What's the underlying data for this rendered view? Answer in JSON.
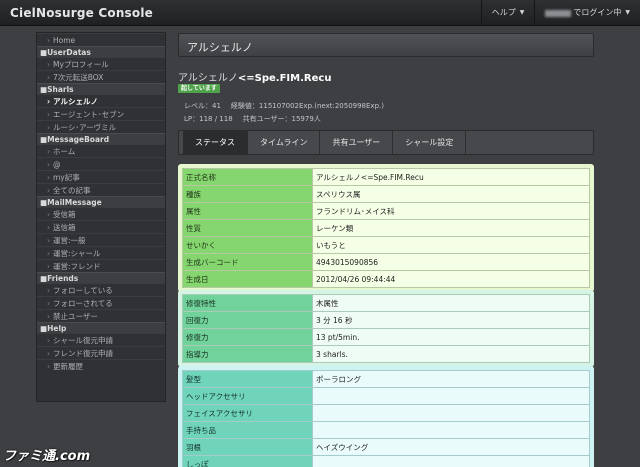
{
  "header": {
    "brand": "CielNosurge Console",
    "help_label": "ヘルプ",
    "login_label": "でログイン中"
  },
  "sidebar": {
    "sections": [
      {
        "title": "",
        "items": [
          {
            "label": "Home",
            "active": false
          }
        ]
      },
      {
        "title": "UserDatas",
        "items": [
          {
            "label": "Myプロフィール",
            "active": false
          },
          {
            "label": "7次元転送BOX",
            "active": false
          }
        ]
      },
      {
        "title": "Sharls",
        "items": [
          {
            "label": "アルシェルノ",
            "active": true
          },
          {
            "label": "エージェント･セブン",
            "active": false
          },
          {
            "label": "ルーシ･アーヴミル",
            "active": false
          }
        ]
      },
      {
        "title": "MessageBoard",
        "items": [
          {
            "label": "ホーム",
            "active": false
          },
          {
            "label": "@",
            "active": false
          },
          {
            "label": "my記事",
            "active": false
          },
          {
            "label": "全ての記事",
            "active": false
          }
        ]
      },
      {
        "title": "MailMessage",
        "items": [
          {
            "label": "受信箱",
            "active": false
          },
          {
            "label": "送信箱",
            "active": false
          },
          {
            "label": "運営:一般",
            "active": false
          },
          {
            "label": "運営:シャール",
            "active": false
          },
          {
            "label": "運営:フレンド",
            "active": false
          }
        ]
      },
      {
        "title": "Friends",
        "items": [
          {
            "label": "フォローしている",
            "active": false
          },
          {
            "label": "フォローされてる",
            "active": false
          },
          {
            "label": "禁止ユーザー",
            "active": false
          }
        ]
      },
      {
        "title": "Help",
        "items": [
          {
            "label": "シャール復元申請",
            "active": false
          },
          {
            "label": "フレンド復元申請",
            "active": false
          },
          {
            "label": "更新履歴",
            "active": false
          }
        ]
      }
    ]
  },
  "page": {
    "title": "アルシェルノ",
    "sharl_name_prefix": "アルシェルノ",
    "sharl_name_suffix": "<=Spe.FIM.Recu",
    "status_badge": "起しています",
    "level": "レベル：41",
    "exp": "経験値：115107002Exp.(next:2050998Exp.)",
    "lp": "LP：118 / 118",
    "shared_users": "共有ユーザー：15979人"
  },
  "tabs": [
    {
      "label": "ステータス",
      "active": true
    },
    {
      "label": "タイムライン",
      "active": false
    },
    {
      "label": "共有ユーザー",
      "active": false
    },
    {
      "label": "シャール設定",
      "active": false
    }
  ],
  "profile_table": [
    {
      "key": "正式名称",
      "value": "アルシェルノ<=Spe.FIM.Recu"
    },
    {
      "key": "種族",
      "value": "スペリウス属"
    },
    {
      "key": "属性",
      "value": "フランドリム･メイス科"
    },
    {
      "key": "性質",
      "value": "レーケン類"
    },
    {
      "key": "せいかく",
      "value": "いもうと"
    },
    {
      "key": "生成バーコード",
      "value": "4943015090856"
    },
    {
      "key": "生成日",
      "value": "2012/04/26 09:44:44"
    }
  ],
  "ability_table": [
    {
      "key": "修復特性",
      "value": "木属性"
    },
    {
      "key": "回復力",
      "value": "3 分 16 秒"
    },
    {
      "key": "修復力",
      "value": "13 pt/5min."
    },
    {
      "key": "指導力",
      "value": "3 sharls."
    }
  ],
  "appearance_table": [
    {
      "key": "髪型",
      "value": "ポーラロング"
    },
    {
      "key": "ヘッドアクセサリ",
      "value": ""
    },
    {
      "key": "フェイスアクセサリ",
      "value": ""
    },
    {
      "key": "手持ち品",
      "value": ""
    },
    {
      "key": "羽根",
      "value": "ヘイズウイング"
    },
    {
      "key": "しっぽ",
      "value": ""
    }
  ],
  "watermark": "ファミ通.com"
}
